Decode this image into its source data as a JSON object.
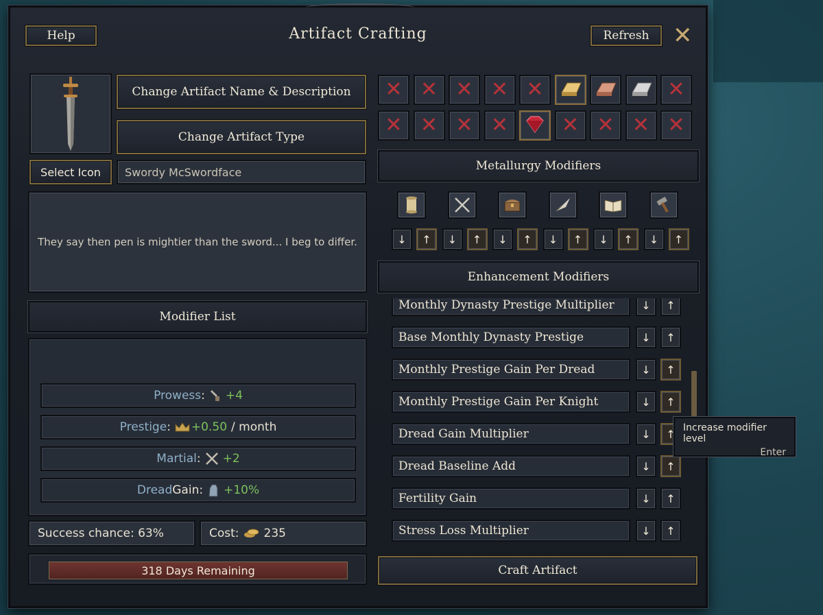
{
  "window": {
    "title": "Artifact Crafting",
    "help_label": "Help",
    "refresh_label": "Refresh",
    "close_glyph": "✕"
  },
  "artifact": {
    "change_name_label": "Change Artifact Name & Description",
    "change_type_label": "Change Artifact Type",
    "select_icon_label": "Select Icon",
    "name_value": "Swordy McSwordface",
    "description": "They say then pen is mightier than the sword... I beg to differ."
  },
  "modifier_list": {
    "header": "Modifier List",
    "rows": [
      {
        "label": "Prowess",
        "suffix": ":",
        "value": "+4",
        "unit": "",
        "icon": "prowess-icon"
      },
      {
        "label": "Prestige",
        "suffix": ":",
        "value": "+0.50",
        "unit": "/ month",
        "icon": "crown-icon"
      },
      {
        "label": "Martial",
        "suffix": ":",
        "value": "+2",
        "unit": "",
        "icon": "crossed-swords-icon"
      },
      {
        "label": "Dread",
        "suffix": " Gain:",
        "value": "+10%",
        "unit": "",
        "icon": "gauntlet-icon"
      }
    ]
  },
  "stats": {
    "success_chance": "Success chance: 63%",
    "cost_label": "Cost:",
    "cost_value": "235"
  },
  "timer": {
    "remaining": "318 Days Remaining"
  },
  "materials": {
    "row1": [
      "x",
      "x",
      "x",
      "x",
      "x",
      "gold-ingot",
      "copper-ingot",
      "silver-ingot",
      "x"
    ],
    "row2": [
      "x",
      "x",
      "x",
      "x",
      "ruby-gem",
      "x",
      "x",
      "x",
      "x"
    ],
    "selected": [
      5,
      13
    ]
  },
  "metallurgy": {
    "header": "Metallurgy Modifiers",
    "categories": [
      "scroll-icon",
      "crossed-swords-icon",
      "chest-icon",
      "quill-icon",
      "book-icon",
      "hammer-icon"
    ],
    "down": "↓",
    "up": "↑"
  },
  "enhancement": {
    "header": "Enhancement Modifiers",
    "rows": [
      {
        "label": "Monthly Dynasty Prestige Multiplier",
        "up_active": false
      },
      {
        "label": "Base Monthly Dynasty Prestige",
        "up_active": false
      },
      {
        "label": "Monthly Prestige Gain Per Dread",
        "up_active": true
      },
      {
        "label": "Monthly Prestige Gain Per Knight",
        "up_active": true
      },
      {
        "label": "Dread Gain Multiplier",
        "up_active": true
      },
      {
        "label": "Dread Baseline Add",
        "up_active": true
      },
      {
        "label": "Fertility Gain",
        "up_active": false
      },
      {
        "label": "Stress Loss Multiplier",
        "up_active": false
      }
    ]
  },
  "craft": {
    "label": "Craft Artifact"
  },
  "tooltip": {
    "text": "Increase modifier level",
    "hotkey": "Enter"
  }
}
